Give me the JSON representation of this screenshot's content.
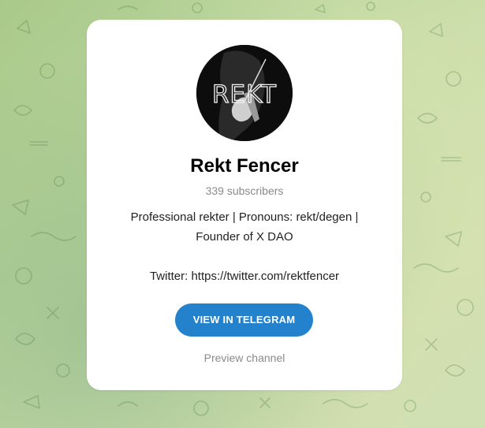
{
  "channel": {
    "title": "Rekt Fencer",
    "subscribers": "339 subscribers",
    "description_line1": "Professional rekter | Pronouns: rekt/degen |",
    "description_line2": "Founder of X DAO",
    "twitter": "Twitter: https://twitter.com/rektfencer",
    "avatar_text": "REKT"
  },
  "actions": {
    "view_label": "VIEW IN TELEGRAM",
    "preview_label": "Preview channel"
  },
  "colors": {
    "button": "#2481cc",
    "muted_text": "#8a8a8a",
    "background": "#b7d39a"
  }
}
